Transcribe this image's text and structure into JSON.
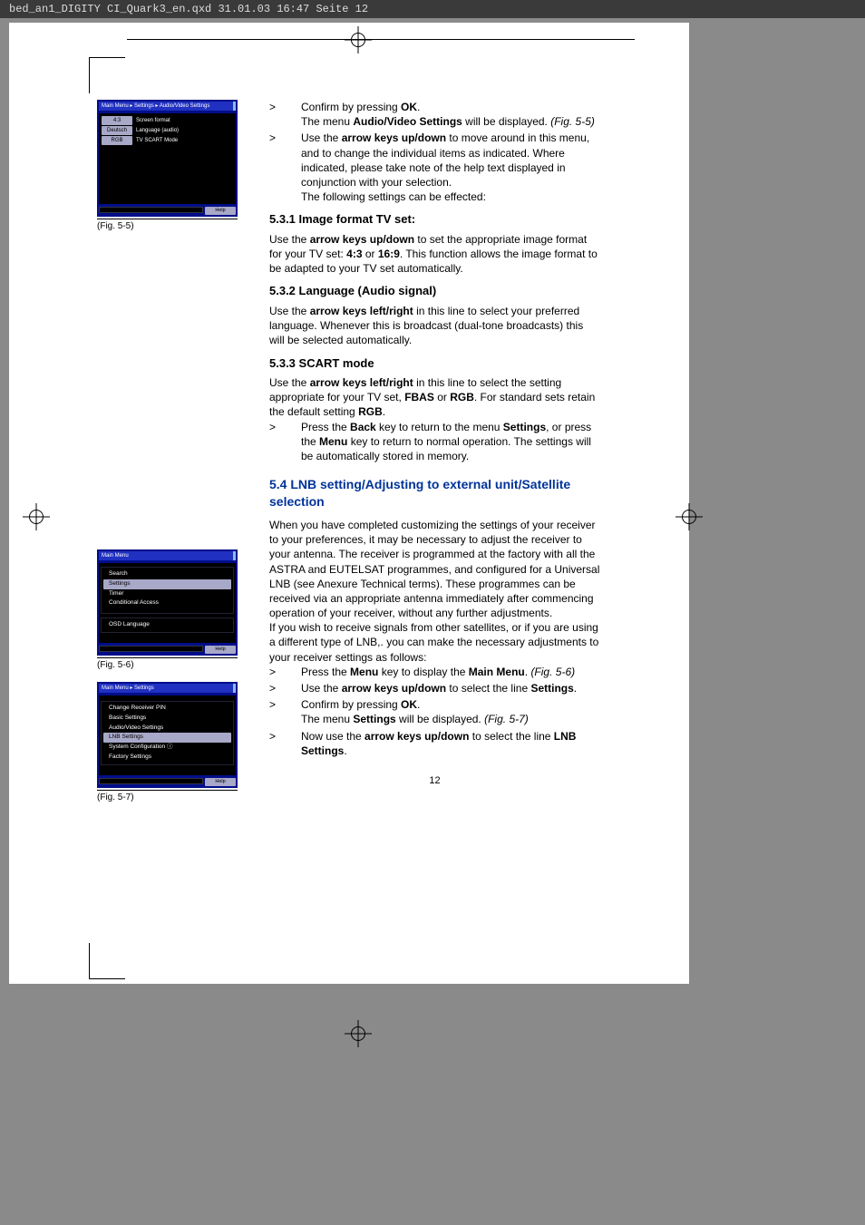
{
  "topbar": "bed_an1_DIGITY CI_Quark3_en.qxd  31.01.03  16:47  Seite 12",
  "fig55": {
    "title": "Main Menu ▸ Settings ▸ Audio/Video Settings",
    "rows": [
      {
        "left": "4:3",
        "right": "Screen format"
      },
      {
        "left": "Deutsch",
        "right": "Language (audio)"
      },
      {
        "left": "RGB",
        "right": "TV SCART Mode"
      }
    ],
    "help": "Help",
    "caption": "(Fig. 5-5)"
  },
  "fig56": {
    "title": "Main Menu",
    "items": [
      "Search",
      "Settings",
      "Timer",
      "Conditional Access",
      "",
      "OSD Language"
    ],
    "help": "Help",
    "caption": "(Fig. 5-6)"
  },
  "fig57": {
    "title": "Main Menu ▸ Settings",
    "items": [
      "Change Receiver PIN",
      "Basic Settings",
      "Audio/Video Settings",
      "LNB Settings",
      "System Configuration ⓘ",
      "Factory Settings"
    ],
    "help": "Help",
    "caption": "(Fig. 5-7)"
  },
  "body": {
    "b1_pre": "Confirm by pressing ",
    "b1_bold": "OK",
    "b1_post": ".",
    "b1_line2a": "The menu ",
    "b1_line2b": "Audio/Video Settings",
    "b1_line2c": " will be displayed. ",
    "b1_fig": "(Fig. 5-5)",
    "b2_pre": "Use the ",
    "b2_bold": "arrow keys up/down",
    "b2_post": " to move around in this menu, and to change the individual items as indicated. Where indicated, please take note of the help text displayed in conjunction with your selection.",
    "b2_last": "The following settings can be effected:",
    "h531": "5.3.1 Image format TV set:",
    "p531a": "Use the ",
    "p531b": "arrow keys up/down",
    "p531c": " to set the appropriate image format for your TV set: ",
    "p531d": "4:3",
    "p531e": " or ",
    "p531f": "16:9",
    "p531g": ". This function allows the image format to be adapted to your TV set automatically.",
    "h532": "5.3.2 Language (Audio signal)",
    "p532a": "Use the ",
    "p532b": "arrow keys left/right",
    "p532c": " in this line to select your preferred language. Whenever this is broadcast (dual-tone broadcasts) this will be selected automatically.",
    "h533": "5.3.3 SCART mode",
    "p533a": "Use the ",
    "p533b": "arrow keys left/right",
    "p533c": " in this line to select the setting appropriate for your TV set, ",
    "p533d": "FBAS",
    "p533e": " or ",
    "p533f": "RGB",
    "p533g": ". For standard sets retain the default setting ",
    "p533h": "RGB",
    "p533i": ".",
    "p533_b1a": "Press the ",
    "p533_b1b": "Back",
    "p533_b1c": " key to return to the menu ",
    "p533_b1d": "Settings",
    "p533_b1e": ", or press the ",
    "p533_b1f": "Menu",
    "p533_b1g": " key to return to normal operation. The settings will be automatically stored in memory.",
    "h54": "5.4 LNB setting/Adjusting to external unit/Satellite selection",
    "p54": "When you have completed customizing the settings of your receiver to your preferences, it may be necessary to adjust the receiver to your antenna. The receiver is programmed at the factory with all the ASTRA and EUTELSAT programmes, and configured for a Universal LNB (see Anexure Technical terms). These programmes can be received via an appropriate antenna immediately after commencing operation of your receiver, without any further adjustments.",
    "p54b": "If you wish to receive signals from other satellites, or if you are using a different type of LNB,. you can make the necessary adjustments to your receiver settings as follows:",
    "b54_1a": "Press the ",
    "b54_1b": "Menu",
    "b54_1c": " key to display the ",
    "b54_1d": "Main Menu",
    "b54_1e": ". ",
    "b54_1f": "(Fig. 5-6)",
    "b54_2a": "Use the ",
    "b54_2b": "arrow keys up/down",
    "b54_2c": " to select the line ",
    "b54_2d": "Settings",
    "b54_2e": ".",
    "b54_3a": "Confirm by pressing ",
    "b54_3b": "OK",
    "b54_3c": ".",
    "b54_3d": "The menu ",
    "b54_3e": "Settings",
    "b54_3f": " will be displayed. ",
    "b54_3g": "(Fig. 5-7)",
    "b54_4a": "Now use the ",
    "b54_4b": "arrow keys up/down",
    "b54_4c": " to select the line ",
    "b54_4d": "LNB Settings",
    "b54_4e": ".",
    "gt": ">",
    "pagenum": "12"
  }
}
